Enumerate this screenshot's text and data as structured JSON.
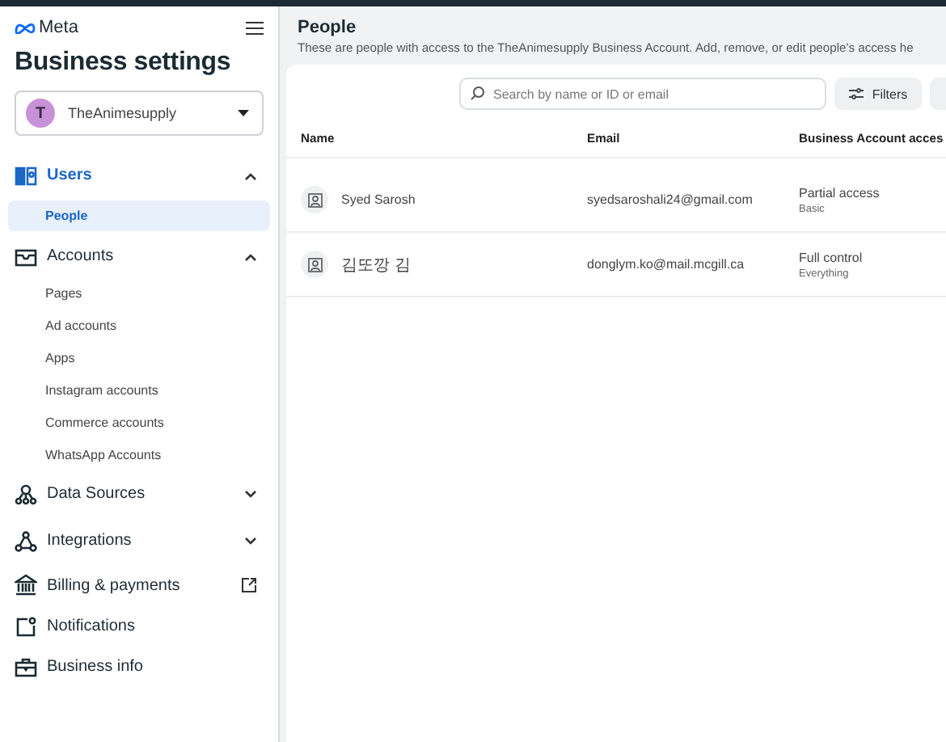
{
  "brand": "Meta",
  "title": "Business settings",
  "account": {
    "initial": "T",
    "name": "TheAnimesupply"
  },
  "nav": [
    {
      "label": "Users",
      "kind": "group",
      "expanded": true,
      "selected": true,
      "children": [
        {
          "label": "People",
          "selected": true
        }
      ]
    },
    {
      "label": "Accounts",
      "kind": "group",
      "expanded": true,
      "selected": false,
      "children": [
        {
          "label": "Pages",
          "selected": false
        },
        {
          "label": "Ad accounts",
          "selected": false
        },
        {
          "label": "Apps",
          "selected": false
        },
        {
          "label": "Instagram accounts",
          "selected": false
        },
        {
          "label": "Commerce accounts",
          "selected": false
        },
        {
          "label": "WhatsApp Accounts",
          "selected": false
        }
      ]
    },
    {
      "label": "Data Sources",
      "kind": "group",
      "expanded": false,
      "selected": false
    },
    {
      "label": "Integrations",
      "kind": "group",
      "expanded": false,
      "selected": false
    },
    {
      "label": "Billing & payments",
      "kind": "external",
      "selected": false
    },
    {
      "label": "Notifications",
      "kind": "link",
      "selected": false
    },
    {
      "label": "Business info",
      "kind": "link",
      "selected": false
    }
  ],
  "page": {
    "title": "People",
    "description": "These are people with access to the TheAnimesupply Business Account. Add, remove, or edit people's access he"
  },
  "search": {
    "placeholder": "Search by name or ID or email"
  },
  "filters_button": "Filters",
  "table": {
    "columns": [
      "Name",
      "Email",
      "Business Account acces"
    ],
    "rows": [
      {
        "name": "Syed Sarosh",
        "email": "syedsaroshali24@gmail.com",
        "access": "Partial access",
        "access_detail": "Basic"
      },
      {
        "name": "김또깡 김",
        "email": "donglym.ko@mail.mcgill.ca",
        "access": "Full control",
        "access_detail": "Everything"
      }
    ]
  }
}
